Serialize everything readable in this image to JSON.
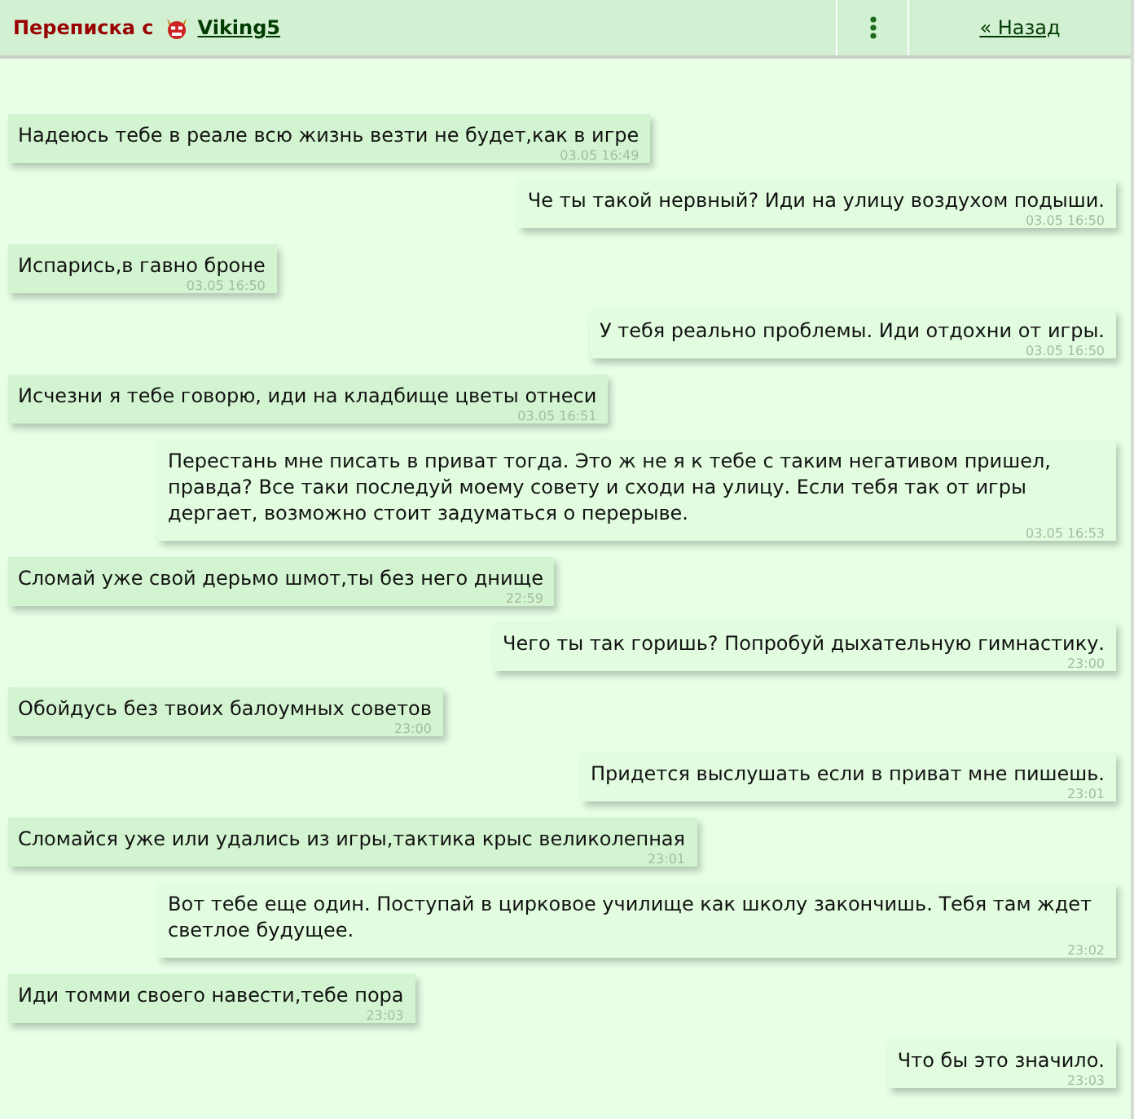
{
  "header": {
    "title": "Переписка с",
    "username": "Viking5",
    "back_link": "« Назад"
  },
  "messages": [
    {
      "kind": "incoming",
      "text": "Надеюсь тебе в реале всю жизнь везти не будет,как в игре",
      "time": "03.05 16:49"
    },
    {
      "kind": "outgoing",
      "text": "Че ты такой нервный? Иди на улицу воздухом подыши.",
      "time": "03.05 16:50"
    },
    {
      "kind": "incoming",
      "text": "Испарись,в гавно броне",
      "time": "03.05 16:50"
    },
    {
      "kind": "outgoing",
      "text": "У тебя реально проблемы. Иди отдохни от игры.",
      "time": "03.05 16:50"
    },
    {
      "kind": "incoming",
      "text": "Исчезни я тебе говорю, иди на кладбище цветы отнеси",
      "time": "03.05 16:51"
    },
    {
      "kind": "outgoing",
      "text": "Перестань мне писать в приват тогда. Это ж не я к тебе с таким негативом пришел, правда? Все таки последуй моему совету и сходи на улицу. Если тебя так от игры дергает, возможно стоит задуматься о перерыве.",
      "time": "03.05 16:53"
    },
    {
      "kind": "incoming",
      "text": "Сломай уже свой дерьмо шмот,ты без него днище",
      "time": "22:59"
    },
    {
      "kind": "outgoing",
      "text": "Чего ты так горишь? Попробуй дыхательную гимнастику.",
      "time": "23:00"
    },
    {
      "kind": "incoming",
      "text": "Обойдусь без твоих балоумных советов",
      "time": "23:00"
    },
    {
      "kind": "outgoing",
      "text": "Придется выслушать если в приват мне пишешь.",
      "time": "23:01"
    },
    {
      "kind": "incoming",
      "text": "Сломайся уже или удались из игры,тактика крыс великолепная",
      "time": "23:01"
    },
    {
      "kind": "outgoing",
      "text": "Вот тебе еще один. Поступай в цирковое училище как школу закончишь. Тебя там ждет светлое будущее.",
      "time": "23:02"
    },
    {
      "kind": "incoming",
      "text": "Иди томми своего навести,тебе пора",
      "time": "23:03"
    },
    {
      "kind": "outgoing",
      "text": "Что бы это значило.",
      "time": "23:03"
    }
  ]
}
